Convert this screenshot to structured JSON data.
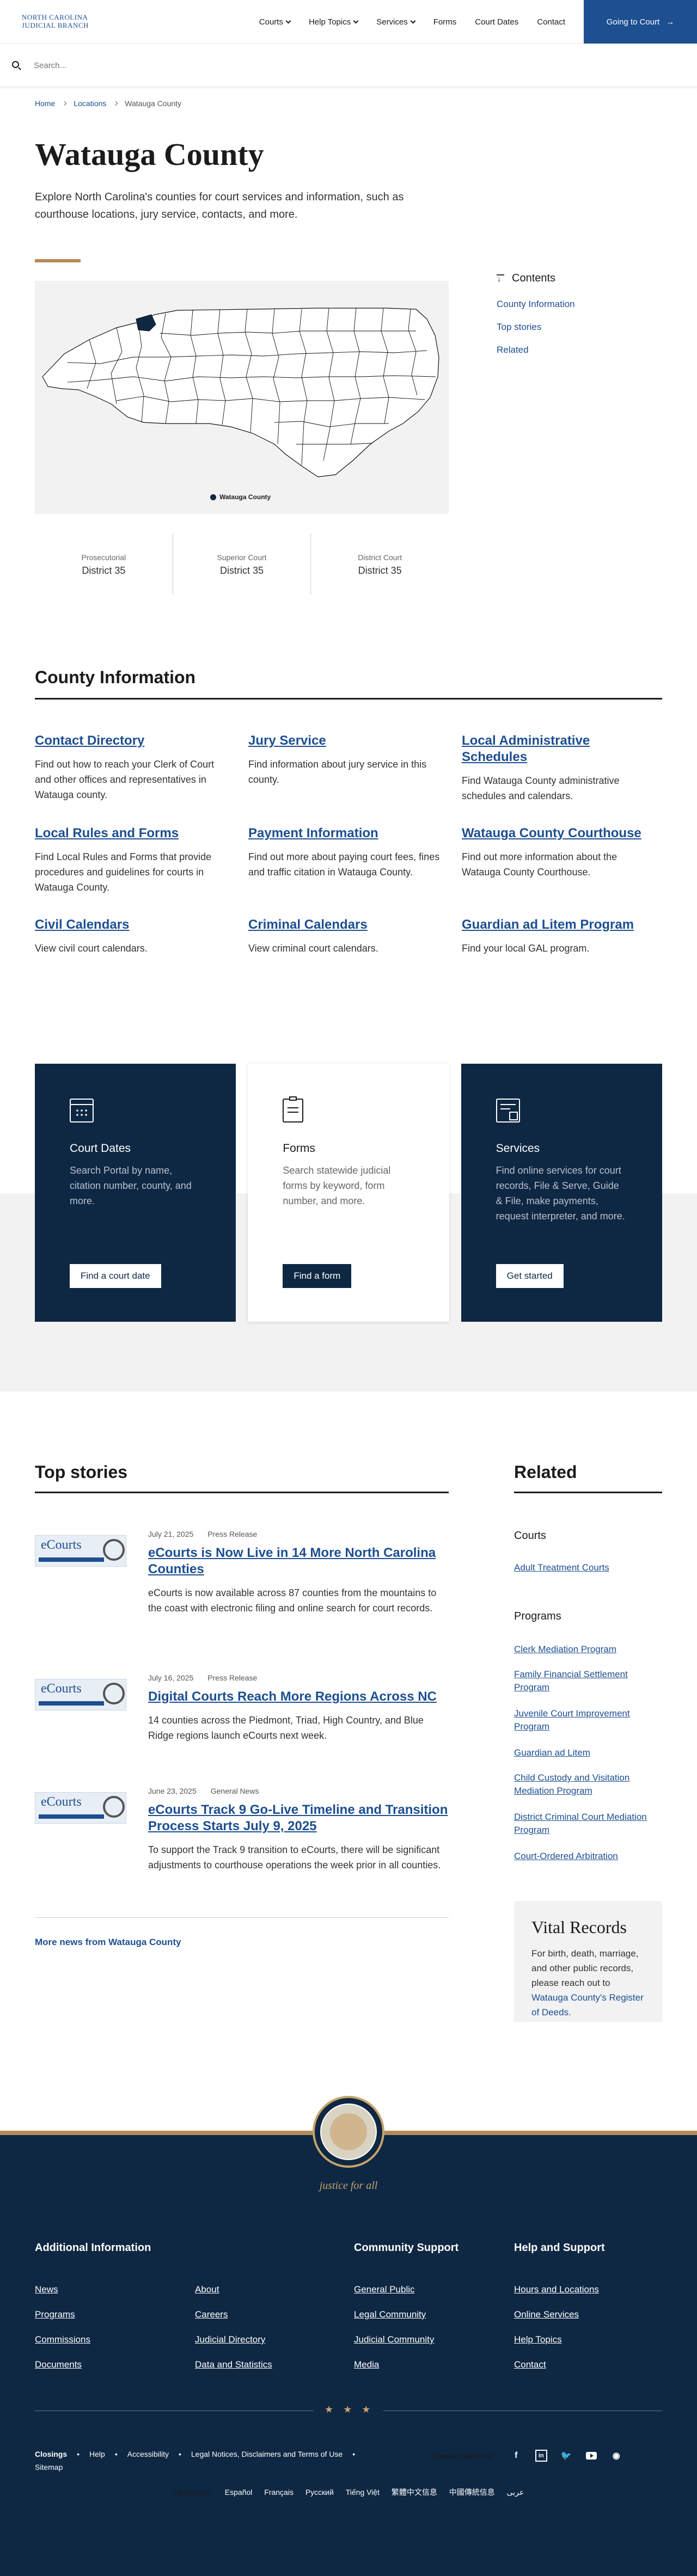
{
  "header": {
    "logo_line1": "North Carolina",
    "logo_line2": "Judicial Branch",
    "nav": [
      "Courts",
      "Help Topics",
      "Services",
      "Forms",
      "Court Dates",
      "Contact"
    ],
    "cta_label": "Going to Court"
  },
  "search": {
    "placeholder": "Search..."
  },
  "breadcrumb": [
    "Home",
    "Locations",
    "Watauga County"
  ],
  "page": {
    "title": "Watauga County",
    "intro": "Explore North Carolina's counties for court services and information, such as courthouse locations, jury service, contacts, and more."
  },
  "map": {
    "legend": "Watauga County",
    "highlight_color": "#0e2743"
  },
  "districts": [
    {
      "label": "Prosecutorial",
      "value": "District 35"
    },
    {
      "label": "Superior Court",
      "value": "District 35"
    },
    {
      "label": "District Court",
      "value": "District 35"
    }
  ],
  "toc": {
    "title": "Contents",
    "links": [
      "County Information",
      "Top stories",
      "Related"
    ]
  },
  "county_info": {
    "title": "County Information",
    "cards": [
      {
        "title": "Contact Directory",
        "desc": "Find out how to reach your Clerk of Court and other offices and representatives in Watauga county."
      },
      {
        "title": "Jury Service",
        "desc": "Find information about jury service in this county."
      },
      {
        "title": "Local Administrative Schedules",
        "desc": "Find Watauga County administrative schedules and calendars."
      },
      {
        "title": "Local Rules and Forms",
        "desc": "Find Local Rules and Forms that provide procedures and guidelines for courts in Watauga County."
      },
      {
        "title": "Payment Information",
        "desc": "Find out more about paying court fees, fines and traffic citation in Watauga County."
      },
      {
        "title": "Watauga County Courthouse",
        "desc": "Find out more information about the Watauga County Courthouse."
      },
      {
        "title": "Civil Calendars",
        "desc": "View civil court calendars."
      },
      {
        "title": "Criminal Calendars",
        "desc": "View criminal court calendars."
      },
      {
        "title": "Guardian ad Litem Program",
        "desc": "Find your local GAL program."
      }
    ]
  },
  "feature_cards": [
    {
      "title": "Court Dates",
      "desc": "Search Portal by name, citation number, county, and more.",
      "button": "Find a court date",
      "icon": "calendar-icon"
    },
    {
      "title": "Forms",
      "desc": "Search statewide judicial forms by keyword, form number, and more.",
      "button": "Find a form",
      "icon": "clipboard-icon"
    },
    {
      "title": "Services",
      "desc": "Find online services for court records, File & Serve, Guide & File, make payments, request interpreter, and more.",
      "button": "Get started",
      "icon": "services-icon"
    }
  ],
  "top_stories": {
    "title": "Top stories",
    "thumb_text": "eCourts",
    "items": [
      {
        "date": "July 21, 2025",
        "type": "Press Release",
        "title": "eCourts is Now Live in 14 More North Carolina Counties",
        "desc": "eCourts is now available across 87 counties from the mountains to the coast with electronic filing and online search for court records."
      },
      {
        "date": "July 16, 2025",
        "type": "Press Release",
        "title": "Digital Courts Reach More Regions Across NC",
        "desc": "14 counties across the Piedmont, Triad, High Country, and Blue Ridge regions launch eCourts next week."
      },
      {
        "date": "June 23, 2025",
        "type": "General News",
        "title": "eCourts Track 9 Go-Live Timeline and Transition Process Starts July 9, 2025",
        "desc": "To support the Track 9 transition to eCourts, there will be significant adjustments to courthouse operations the week prior in all counties."
      }
    ],
    "more_link": "More news from Watauga County"
  },
  "related": {
    "title": "Related",
    "courts_heading": "Courts",
    "courts": [
      "Adult Treatment Courts"
    ],
    "programs_heading": "Programs",
    "programs": [
      "Clerk Mediation Program",
      "Family Financial Settlement Program",
      "Juvenile Court Improvement Program",
      "Guardian ad Litem",
      "Child Custody and Visitation Mediation Program",
      "District Criminal Court Mediation Program",
      "Court-Ordered Arbitration"
    ]
  },
  "vital": {
    "title": "Vital Records",
    "text": "For birth, death, marriage, and other public records, please reach out to",
    "link": "Watauga County's Register of Deeds."
  },
  "footer": {
    "motto": "justice for all",
    "additional_title": "Additional Information",
    "additional_col1": [
      "News",
      "Programs",
      "Commissions",
      "Documents"
    ],
    "additional_col2": [
      "About",
      "Careers",
      "Judicial Directory",
      "Data and Statistics"
    ],
    "community_title": "Community Support",
    "community": [
      "General Public",
      "Legal Community",
      "Judicial Community",
      "Media"
    ],
    "help_title": "Help and Support",
    "help": [
      "Hours and Locations",
      "Online Services",
      "Help Topics",
      "Contact"
    ],
    "stars": "★★★",
    "legal_links": [
      "Closings",
      "Help",
      "Accessibility",
      "Legal Notices, Disclaimers and Terms of Use",
      "Sitemap"
    ],
    "connect": "Connect with us:",
    "social_icons": [
      "facebook-icon",
      "linkedin-icon",
      "twitter-icon",
      "youtube-icon",
      "podcast-icon"
    ],
    "languages_label": "Languages:",
    "languages": [
      "Español",
      "Français",
      "Русский",
      "Tiếng Việt",
      "繁體中文信息",
      "中國傳統信息",
      "عربى"
    ]
  }
}
